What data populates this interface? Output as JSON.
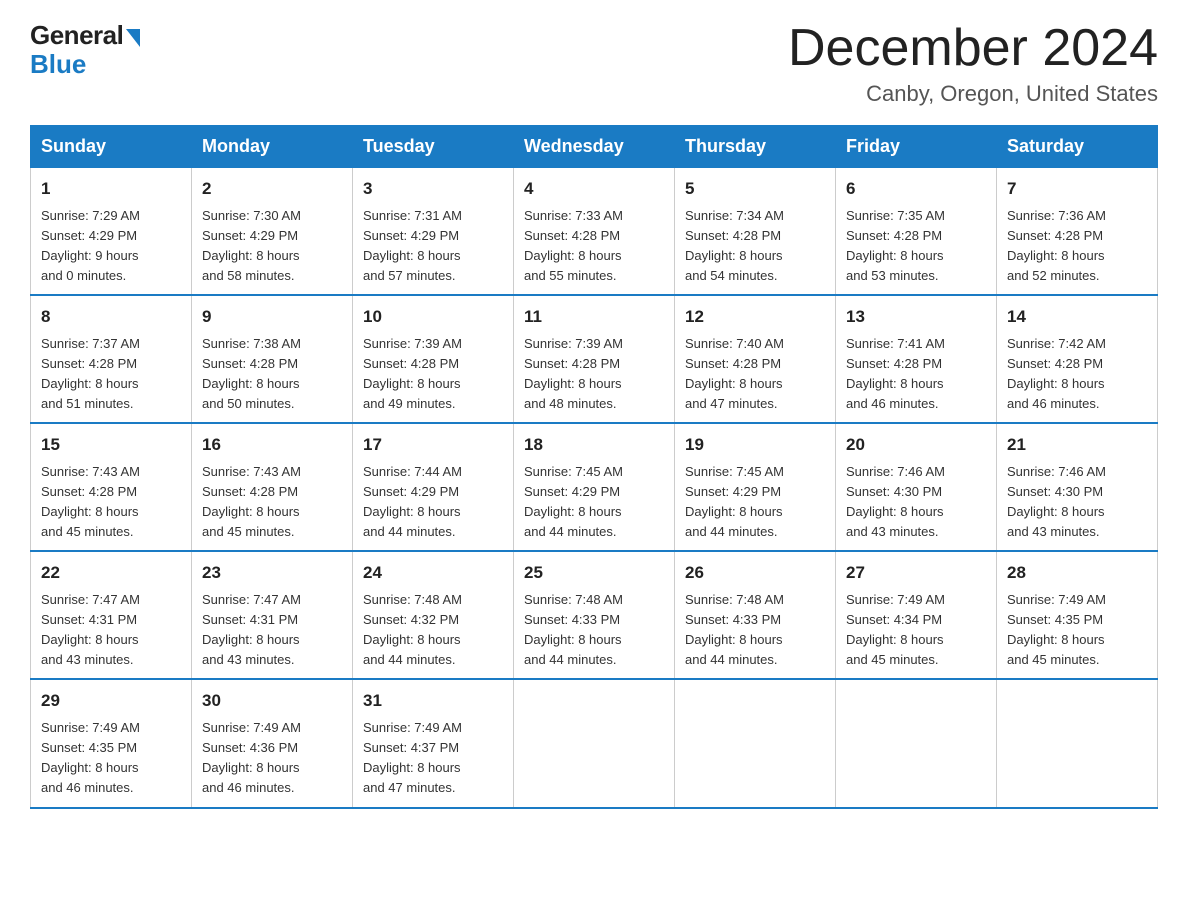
{
  "logo": {
    "text_general": "General",
    "text_blue": "Blue"
  },
  "title": {
    "month": "December 2024",
    "location": "Canby, Oregon, United States"
  },
  "days_of_week": [
    "Sunday",
    "Monday",
    "Tuesday",
    "Wednesday",
    "Thursday",
    "Friday",
    "Saturday"
  ],
  "weeks": [
    [
      {
        "day": "1",
        "sunrise": "7:29 AM",
        "sunset": "4:29 PM",
        "daylight": "9 hours and 0 minutes."
      },
      {
        "day": "2",
        "sunrise": "7:30 AM",
        "sunset": "4:29 PM",
        "daylight": "8 hours and 58 minutes."
      },
      {
        "day": "3",
        "sunrise": "7:31 AM",
        "sunset": "4:29 PM",
        "daylight": "8 hours and 57 minutes."
      },
      {
        "day": "4",
        "sunrise": "7:33 AM",
        "sunset": "4:28 PM",
        "daylight": "8 hours and 55 minutes."
      },
      {
        "day": "5",
        "sunrise": "7:34 AM",
        "sunset": "4:28 PM",
        "daylight": "8 hours and 54 minutes."
      },
      {
        "day": "6",
        "sunrise": "7:35 AM",
        "sunset": "4:28 PM",
        "daylight": "8 hours and 53 minutes."
      },
      {
        "day": "7",
        "sunrise": "7:36 AM",
        "sunset": "4:28 PM",
        "daylight": "8 hours and 52 minutes."
      }
    ],
    [
      {
        "day": "8",
        "sunrise": "7:37 AM",
        "sunset": "4:28 PM",
        "daylight": "8 hours and 51 minutes."
      },
      {
        "day": "9",
        "sunrise": "7:38 AM",
        "sunset": "4:28 PM",
        "daylight": "8 hours and 50 minutes."
      },
      {
        "day": "10",
        "sunrise": "7:39 AM",
        "sunset": "4:28 PM",
        "daylight": "8 hours and 49 minutes."
      },
      {
        "day": "11",
        "sunrise": "7:39 AM",
        "sunset": "4:28 PM",
        "daylight": "8 hours and 48 minutes."
      },
      {
        "day": "12",
        "sunrise": "7:40 AM",
        "sunset": "4:28 PM",
        "daylight": "8 hours and 47 minutes."
      },
      {
        "day": "13",
        "sunrise": "7:41 AM",
        "sunset": "4:28 PM",
        "daylight": "8 hours and 46 minutes."
      },
      {
        "day": "14",
        "sunrise": "7:42 AM",
        "sunset": "4:28 PM",
        "daylight": "8 hours and 46 minutes."
      }
    ],
    [
      {
        "day": "15",
        "sunrise": "7:43 AM",
        "sunset": "4:28 PM",
        "daylight": "8 hours and 45 minutes."
      },
      {
        "day": "16",
        "sunrise": "7:43 AM",
        "sunset": "4:28 PM",
        "daylight": "8 hours and 45 minutes."
      },
      {
        "day": "17",
        "sunrise": "7:44 AM",
        "sunset": "4:29 PM",
        "daylight": "8 hours and 44 minutes."
      },
      {
        "day": "18",
        "sunrise": "7:45 AM",
        "sunset": "4:29 PM",
        "daylight": "8 hours and 44 minutes."
      },
      {
        "day": "19",
        "sunrise": "7:45 AM",
        "sunset": "4:29 PM",
        "daylight": "8 hours and 44 minutes."
      },
      {
        "day": "20",
        "sunrise": "7:46 AM",
        "sunset": "4:30 PM",
        "daylight": "8 hours and 43 minutes."
      },
      {
        "day": "21",
        "sunrise": "7:46 AM",
        "sunset": "4:30 PM",
        "daylight": "8 hours and 43 minutes."
      }
    ],
    [
      {
        "day": "22",
        "sunrise": "7:47 AM",
        "sunset": "4:31 PM",
        "daylight": "8 hours and 43 minutes."
      },
      {
        "day": "23",
        "sunrise": "7:47 AM",
        "sunset": "4:31 PM",
        "daylight": "8 hours and 43 minutes."
      },
      {
        "day": "24",
        "sunrise": "7:48 AM",
        "sunset": "4:32 PM",
        "daylight": "8 hours and 44 minutes."
      },
      {
        "day": "25",
        "sunrise": "7:48 AM",
        "sunset": "4:33 PM",
        "daylight": "8 hours and 44 minutes."
      },
      {
        "day": "26",
        "sunrise": "7:48 AM",
        "sunset": "4:33 PM",
        "daylight": "8 hours and 44 minutes."
      },
      {
        "day": "27",
        "sunrise": "7:49 AM",
        "sunset": "4:34 PM",
        "daylight": "8 hours and 45 minutes."
      },
      {
        "day": "28",
        "sunrise": "7:49 AM",
        "sunset": "4:35 PM",
        "daylight": "8 hours and 45 minutes."
      }
    ],
    [
      {
        "day": "29",
        "sunrise": "7:49 AM",
        "sunset": "4:35 PM",
        "daylight": "8 hours and 46 minutes."
      },
      {
        "day": "30",
        "sunrise": "7:49 AM",
        "sunset": "4:36 PM",
        "daylight": "8 hours and 46 minutes."
      },
      {
        "day": "31",
        "sunrise": "7:49 AM",
        "sunset": "4:37 PM",
        "daylight": "8 hours and 47 minutes."
      },
      null,
      null,
      null,
      null
    ]
  ],
  "labels": {
    "sunrise": "Sunrise:",
    "sunset": "Sunset:",
    "daylight": "Daylight:"
  }
}
